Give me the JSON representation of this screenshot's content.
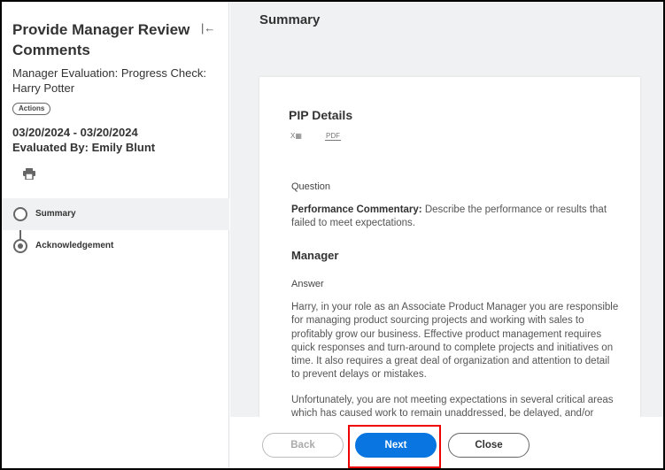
{
  "sidebar": {
    "title": "Provide Manager Review Comments",
    "subtitle": "Manager Evaluation: Progress Check: Harry Potter",
    "actions_label": "Actions",
    "date_range": "03/20/2024 - 03/20/2024",
    "evaluated_by": "Evaluated By: Emily Blunt",
    "steps": [
      {
        "label": "Summary",
        "active": true
      },
      {
        "label": "Acknowledgement",
        "active": false
      }
    ]
  },
  "main": {
    "title": "Summary",
    "card": {
      "title": "PIP Details",
      "excel_icon": "excel-export-icon",
      "pdf_icon": "pdf-export-icon",
      "pdf_label": "PDF",
      "excel_label": "X",
      "question_label": "Question",
      "question_bold": "Performance Commentary:",
      "question_text": " Describe the performance or results that failed to meet expectations.",
      "section": "Manager",
      "answer_label": "Answer",
      "answer_p1": "Harry, in your role as an Associate Product Manager you are responsible for managing product sourcing projects and working with sales to profitably grow our business. Effective product management requires quick responses and turn-around to complete projects and initiatives on time. It also requires a great deal of organization and attention to detail to prevent delays or mistakes.",
      "answer_p2": "Unfortunately, you are not meeting expectations in several critical areas which has caused work to remain unaddressed, be delayed, and/or"
    }
  },
  "footer": {
    "back": "Back",
    "next": "Next",
    "close": "Close"
  },
  "colors": {
    "primary": "#0875e1",
    "highlight": "#e00000"
  }
}
